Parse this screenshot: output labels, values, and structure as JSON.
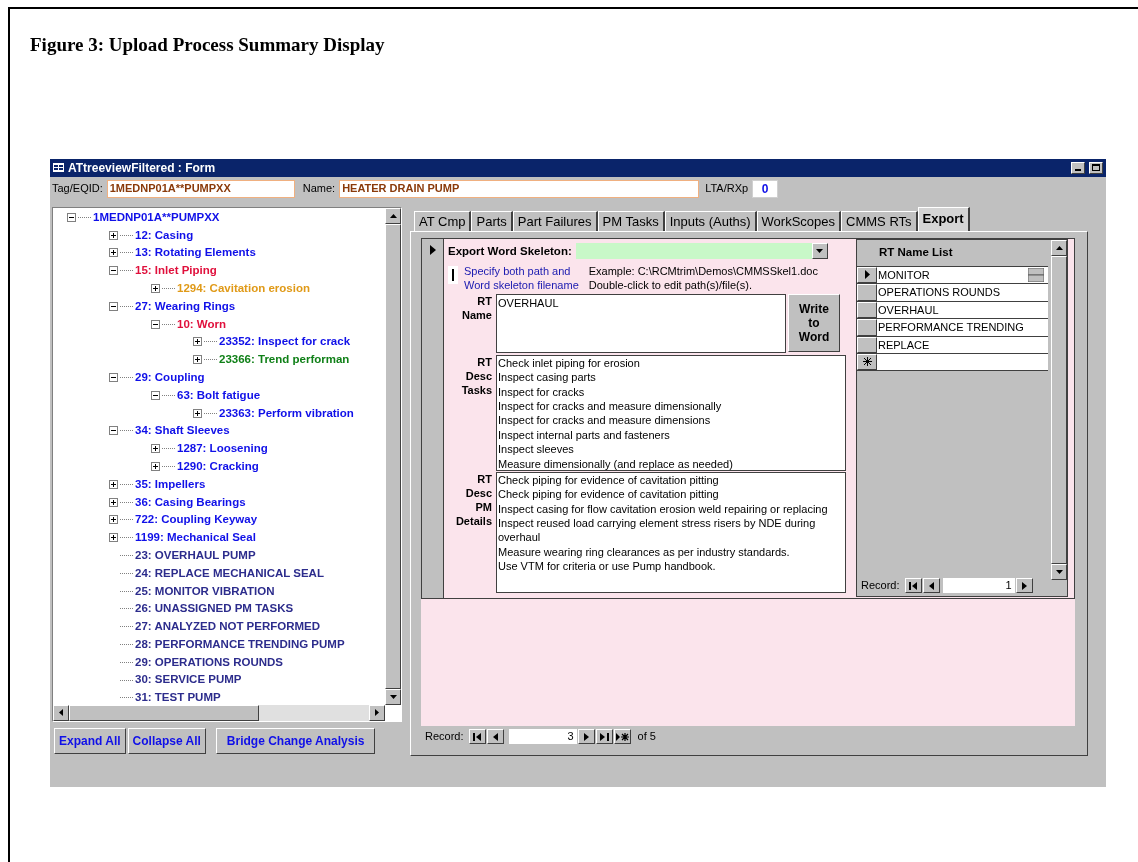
{
  "caption": "Figure 3: Upload Process Summary Display",
  "window": {
    "title": "ATtreeviewFiltered : Form"
  },
  "header": {
    "tag_label": "Tag/EQID:",
    "tag_value": "1MEDNP01A**PUMPXX",
    "name_label": "Name:",
    "name_value": "HEATER DRAIN PUMP",
    "lta_label": "LTA/RXp",
    "lta_value": "0"
  },
  "tree": [
    {
      "label": "1MEDNP01A**PUMPXX",
      "color": "#1010e8",
      "kind": "branch",
      "expanded": true,
      "children": [
        {
          "label": "12: Casing",
          "color": "#1010e8",
          "kind": "branch",
          "expanded": false
        },
        {
          "label": "13: Rotating Elements",
          "color": "#1010e8",
          "kind": "branch",
          "expanded": false
        },
        {
          "label": "15: Inlet Piping",
          "color": "#e0103c",
          "kind": "branch",
          "expanded": true,
          "children": [
            {
              "label": "1294: Cavitation erosion",
              "color": "#e09a18",
              "kind": "branch",
              "expanded": false
            }
          ]
        },
        {
          "label": "27: Wearing Rings",
          "color": "#1010e8",
          "kind": "branch",
          "expanded": true,
          "children": [
            {
              "label": "10: Worn",
              "color": "#e0103c",
              "kind": "branch",
              "expanded": true,
              "children": [
                {
                  "label": "23352: Inspect for crack",
                  "color": "#1010e8",
                  "kind": "branch",
                  "expanded": false
                },
                {
                  "label": "23366: Trend performan",
                  "color": "#108018",
                  "kind": "branch",
                  "expanded": false
                }
              ]
            }
          ]
        },
        {
          "label": "29: Coupling",
          "color": "#1010e8",
          "kind": "branch",
          "expanded": true,
          "children": [
            {
              "label": "63: Bolt fatigue",
              "color": "#1010e8",
              "kind": "branch",
              "expanded": true,
              "children": [
                {
                  "label": "23363: Perform vibration",
                  "color": "#1010e8",
                  "kind": "branch",
                  "expanded": false
                }
              ]
            }
          ]
        },
        {
          "label": "34: Shaft Sleeves",
          "color": "#1010e8",
          "kind": "branch",
          "expanded": true,
          "children": [
            {
              "label": "1287: Loosening",
              "color": "#1010e8",
              "kind": "branch",
              "expanded": false
            },
            {
              "label": "1290: Cracking",
              "color": "#1010e8",
              "kind": "branch",
              "expanded": false
            }
          ]
        },
        {
          "label": "35: Impellers",
          "color": "#1010e8",
          "kind": "branch",
          "expanded": false
        },
        {
          "label": "36: Casing Bearings",
          "color": "#1010e8",
          "kind": "branch",
          "expanded": false
        },
        {
          "label": "722: Coupling Keyway",
          "color": "#1010e8",
          "kind": "branch",
          "expanded": false
        },
        {
          "label": "1199: Mechanical Seal",
          "color": "#1010e8",
          "kind": "branch",
          "expanded": false
        },
        {
          "label": "23: OVERHAUL PUMP",
          "color": "#2c2c8c",
          "kind": "leaf"
        },
        {
          "label": "24: REPLACE MECHANICAL SEAL",
          "color": "#2c2c8c",
          "kind": "leaf"
        },
        {
          "label": "25: MONITOR VIBRATION",
          "color": "#2c2c8c",
          "kind": "leaf"
        },
        {
          "label": "26: UNASSIGNED PM TASKS",
          "color": "#2c2c8c",
          "kind": "leaf"
        },
        {
          "label": "27: ANALYZED NOT PERFORMED",
          "color": "#2c2c8c",
          "kind": "leaf"
        },
        {
          "label": "28: PERFORMANCE TRENDING PUMP",
          "color": "#2c2c8c",
          "kind": "leaf"
        },
        {
          "label": "29: OPERATIONS ROUNDS",
          "color": "#2c2c8c",
          "kind": "leaf"
        },
        {
          "label": "30: SERVICE PUMP",
          "color": "#2c2c8c",
          "kind": "leaf"
        },
        {
          "label": "31: TEST PUMP",
          "color": "#2c2c8c",
          "kind": "leaf"
        }
      ]
    }
  ],
  "buttons": [
    "Expand All",
    "Collapse All",
    "Bridge Change Analysis"
  ],
  "tabs": [
    {
      "label": "AT Cmp",
      "selected": false
    },
    {
      "label": "Parts",
      "selected": false
    },
    {
      "label": "Part Failures",
      "selected": false
    },
    {
      "label": "PM Tasks",
      "selected": false
    },
    {
      "label": "Inputs (Auths)",
      "selected": false
    },
    {
      "label": "WorkScopes",
      "selected": false
    },
    {
      "label": "CMMS RTs",
      "selected": false
    },
    {
      "label": "Export",
      "selected": true
    }
  ],
  "export": {
    "skeleton_label": "Export Word Skeleton:",
    "hint": [
      "Specify both path and",
      "Word skeleton filename"
    ],
    "example": [
      "Example: C:\\RCMtrim\\Demos\\CMMSSkel1.doc",
      "Double-click to edit path(s)/file(s)."
    ],
    "rt_name_label": [
      "RT",
      "Name"
    ],
    "rt_name_value": "OVERHAUL",
    "write_button": "Write to Word",
    "tasks_label": [
      "RT",
      "Desc",
      "Tasks"
    ],
    "tasks": [
      "Check inlet piping for erosion",
      "Inspect casing parts",
      "Inspect for cracks",
      "Inspect for cracks and measure dimensionally",
      "Inspect for cracks and measure dimensions",
      "Inspect internal parts and fasteners",
      "Inspect sleeves",
      "Measure dimensionally (and replace as needed)"
    ],
    "details_label": [
      "RT",
      "Desc",
      "PM",
      "Details"
    ],
    "details": [
      "Check piping for evidence of cavitation pitting",
      "Check piping for evidence of cavitation pitting",
      "Inspect casing for flow cavitation erosion weld repairing or replacing",
      "Inspect reused load carrying element stress risers by NDE during overhaul",
      "Measure wearing ring clearances as per industry standards.",
      "Use VTM for criteria or use Pump handbook."
    ]
  },
  "rt_list": {
    "title": "RT Name List",
    "rows": [
      {
        "name": "MONITOR",
        "selected": true
      },
      {
        "name": "OPERATIONS ROUNDS",
        "selected": false
      },
      {
        "name": "OVERHAUL",
        "selected": false
      },
      {
        "name": "PERFORMANCE TRENDING",
        "selected": false
      },
      {
        "name": "REPLACE",
        "selected": false
      }
    ],
    "record_label": "Record:",
    "record_value": "1"
  },
  "record_nav": {
    "label": "Record:",
    "value": "3",
    "total": "of 5"
  }
}
